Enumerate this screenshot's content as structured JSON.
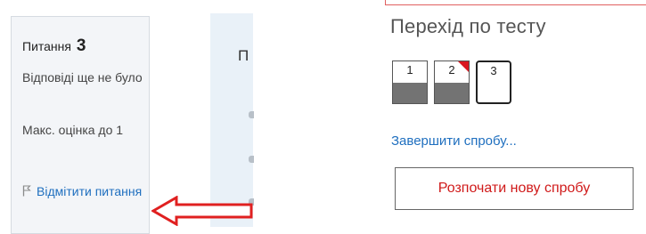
{
  "question_info": {
    "label": "Питання",
    "number": "3",
    "state": "Відповіді ще не було",
    "grade": "Макс. оцінка до 1",
    "flag_text": "Відмітити питання"
  },
  "content_preview": {
    "first_char": "П"
  },
  "quiz_navigation": {
    "title": "Перехід по тесту",
    "buttons": [
      {
        "label": "1",
        "answered": true,
        "flagged": false,
        "current": false
      },
      {
        "label": "2",
        "answered": true,
        "flagged": true,
        "current": false
      },
      {
        "label": "3",
        "answered": false,
        "flagged": false,
        "current": true
      }
    ],
    "finish_link": "Завершити спробу...",
    "new_attempt_button": "Розпочати нову спробу"
  },
  "colors": {
    "link": "#1f6fbf",
    "flag_marker": "#d9161f",
    "annotation_arrow": "#e02020",
    "new_attempt_text": "#d01a1a",
    "answered_fill": "#737373"
  },
  "icons": [
    "flag-icon",
    "arrow-annotation"
  ]
}
